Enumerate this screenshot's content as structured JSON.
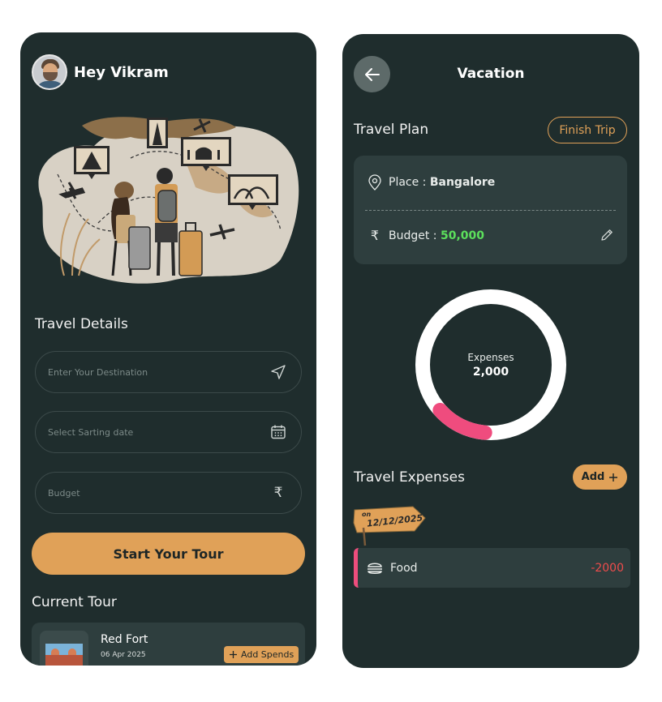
{
  "left": {
    "greeting": "Hey Vikram",
    "travel_details_title": "Travel Details",
    "destination_placeholder": "Enter Your Destination",
    "date_placeholder": "Select Sarting date",
    "budget_placeholder": "Budget",
    "start_button": "Start Your Tour",
    "current_tour_title": "Current Tour",
    "tour": {
      "name": "Red Fort",
      "date": "06 Apr 2025",
      "add_spends": "Add Spends"
    }
  },
  "right": {
    "title": "Vacation",
    "travel_plan_title": "Travel Plan",
    "finish_trip": "Finish Trip",
    "place_label": "Place :",
    "place_value": "Bangalore",
    "budget_label": "Budget :",
    "budget_value": "50,000",
    "donut": {
      "label": "Expenses",
      "value": "2,000",
      "spent_fraction": 0.12
    },
    "travel_expenses_title": "Travel Expenses",
    "add_button": "Add",
    "date_tag_on": "on",
    "date_tag_date": "12/12/2025",
    "expense": {
      "name": "Food",
      "amount": "-2000"
    }
  },
  "colors": {
    "background": "#1f2d2d",
    "card": "#2e3e3e",
    "accent": "#e0a158",
    "budget_green": "#5ce05c",
    "expense_red": "#ef4c4c",
    "expense_bar": "#ee4d7d"
  },
  "icons": [
    "avatar",
    "travel-illustration",
    "send-icon",
    "calendar-icon",
    "rupee-icon",
    "plus-icon",
    "back-arrow-icon",
    "location-pin-icon",
    "pencil-icon",
    "burger-icon"
  ]
}
